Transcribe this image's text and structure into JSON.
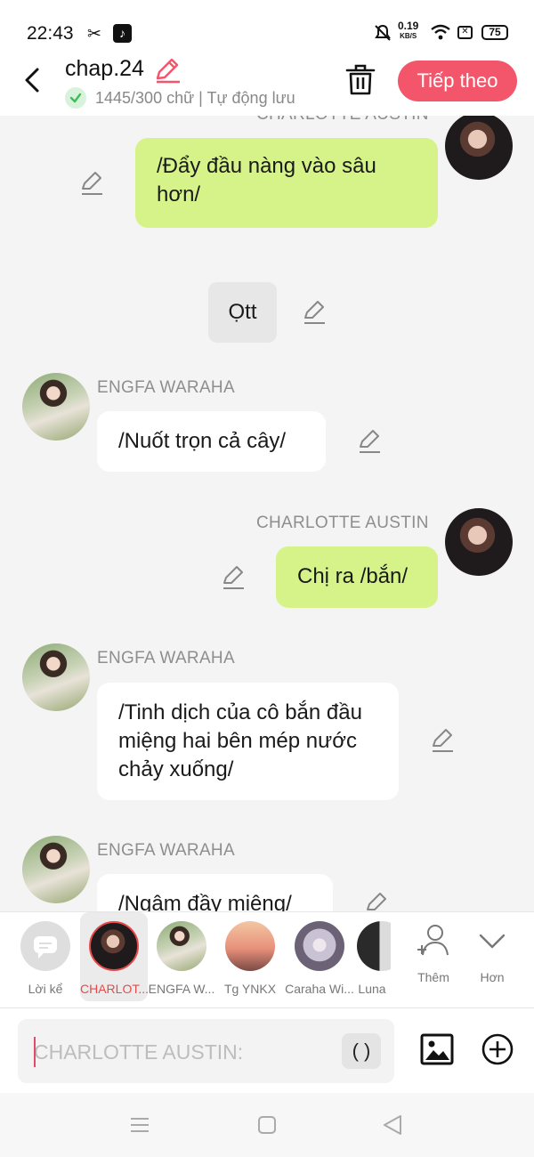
{
  "status_bar": {
    "time": "22:43",
    "app_icon_1": "capcut-icon",
    "app_icon_2": "tiktok-icon",
    "speed_value": "0.19",
    "speed_unit": "KB/S",
    "battery": "75"
  },
  "header": {
    "title": "chap.24",
    "subtitle": "1445/300 chữ | Tự động lưu",
    "next_label": "Tiếp theo"
  },
  "messages": [
    {
      "id": "m1",
      "side": "right",
      "sender": "CHARLOTTE AUSTIN",
      "text": "/Đẩy đầu nàng vào sâu hơn/"
    },
    {
      "id": "m2",
      "side": "center",
      "sender": "",
      "text": "Ọtt"
    },
    {
      "id": "m3",
      "side": "left",
      "sender": "ENGFA WARAHA",
      "text": "/Nuốt trọn cả cây/"
    },
    {
      "id": "m4",
      "side": "right",
      "sender": "CHARLOTTE AUSTIN",
      "text": "Chị ra /bắn/"
    },
    {
      "id": "m5",
      "side": "left",
      "sender": "ENGFA WARAHA",
      "text": "/Tinh dịch của cô bắn đầu miệng hai bên mép nước chảy xuống/"
    },
    {
      "id": "m6",
      "side": "left",
      "sender": "ENGFA WARAHA",
      "text": "/Ngậm đầy miệng/"
    }
  ],
  "characters": [
    {
      "label": "Lời kể",
      "selected": false
    },
    {
      "label": "CHARLOT...",
      "selected": true
    },
    {
      "label": "ENGFA W...",
      "selected": false
    },
    {
      "label": "Tg YNKX",
      "selected": false
    },
    {
      "label": "Caraha Wi...",
      "selected": false
    },
    {
      "label": "Luna",
      "selected": false
    }
  ],
  "strip_buttons": {
    "add_label": "Thêm",
    "more_label": "Hơn"
  },
  "input": {
    "placeholder": "CHARLOTTE AUSTIN:",
    "paren": "( )"
  },
  "colors": {
    "accent": "#f3566b",
    "bubble_green": "#d6f38a",
    "selected_red": "#e64a4a"
  }
}
